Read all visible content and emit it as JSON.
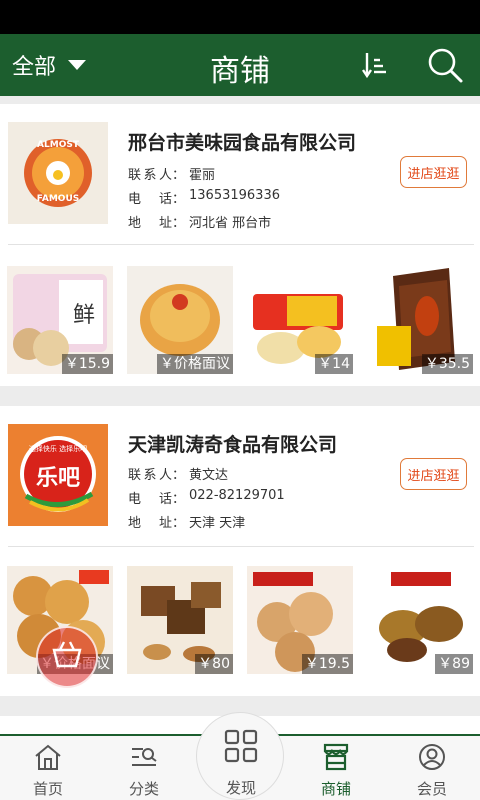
{
  "header": {
    "filter_label": "全部",
    "title": "商铺"
  },
  "shops": [
    {
      "name": "邢台市美味园食品有限公司",
      "logo_text_top": "ALMOST",
      "logo_text_bottom": "FAMOUS",
      "contact_label": "联系人",
      "contact": "霍丽",
      "phone_label": "电话",
      "phone": "13653196336",
      "address_label": "地址",
      "address": "河北省 邢台市",
      "visit_label": "进店逛逛",
      "products": [
        {
          "price": "￥15.9",
          "desc": "鲜花饼"
        },
        {
          "price": "￥价格面议",
          "desc": "cake"
        },
        {
          "price": "￥14",
          "desc": "pastry"
        },
        {
          "price": "￥35.5",
          "desc": "chocolate-box"
        }
      ]
    },
    {
      "name": "天津凯涛奇食品有限公司",
      "logo_text": "乐吧",
      "logo_subtext": "选择快乐 选择乐吧",
      "contact_label": "联系人",
      "contact": "黄文达",
      "phone_label": "电话",
      "phone": "022-82129701",
      "address_label": "地址",
      "address": "天津 天津",
      "visit_label": "进店逛逛",
      "products": [
        {
          "price": "￥价格面议",
          "desc": "mooncakes"
        },
        {
          "price": "￥80",
          "desc": "brown-sugar"
        },
        {
          "price": "￥19.5",
          "desc": "pastries"
        },
        {
          "price": "￥89",
          "desc": "mooncake"
        }
      ]
    }
  ],
  "nav": {
    "home": "首页",
    "category": "分类",
    "discover": "发现",
    "shops": "商铺",
    "member": "会员"
  },
  "colors": {
    "brand_green": "#1c5e2e",
    "visit_orange": "#e24a1a"
  }
}
